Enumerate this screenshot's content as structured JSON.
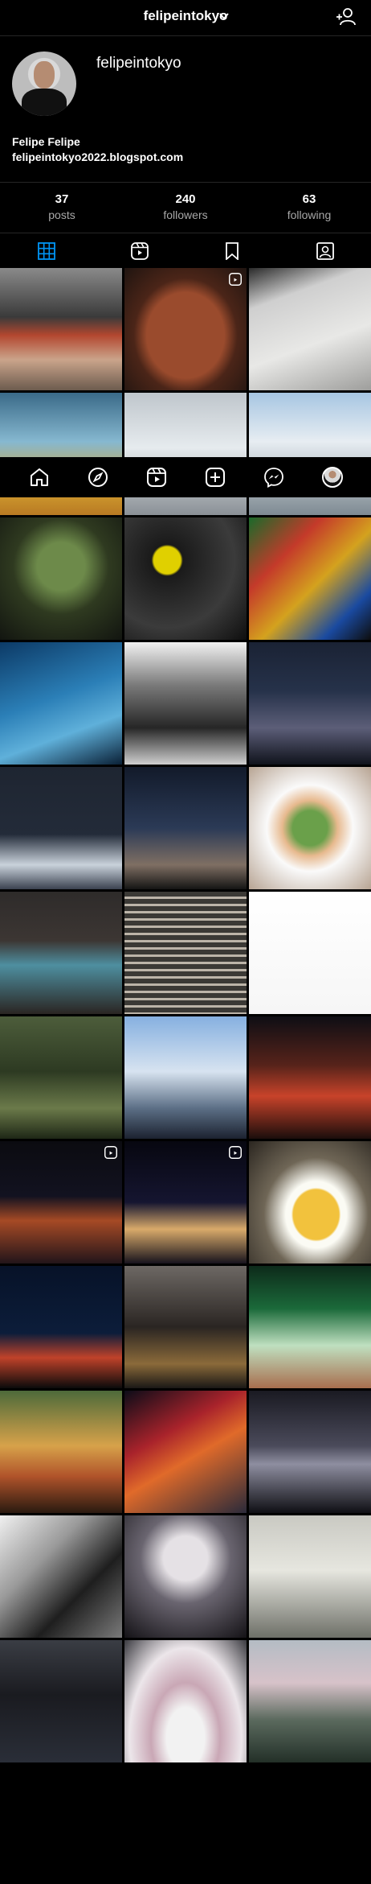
{
  "header": {
    "username": "felipeintokyo",
    "switch_icon": "chevron-down-icon",
    "add_user_icon": "add-user-icon"
  },
  "profile": {
    "handle": "felipeintokyo",
    "name": "Felipe Felipe",
    "link": "felipeintokyo2022.blogspot.com"
  },
  "stats": [
    {
      "number": "37",
      "label": "posts"
    },
    {
      "number": "240",
      "label": "followers"
    },
    {
      "number": "63",
      "label": "following"
    }
  ],
  "tabs": [
    "grid-icon",
    "reels-icon",
    "saved-icon",
    "tagged-icon"
  ],
  "bottom_nav": [
    "home-icon",
    "explore-icon",
    "reels-icon",
    "new-post-icon",
    "messenger-icon",
    "profile-avatar"
  ],
  "colors": {
    "background": "#000000",
    "divider": "#262626",
    "muted": "#a8a8a8"
  }
}
